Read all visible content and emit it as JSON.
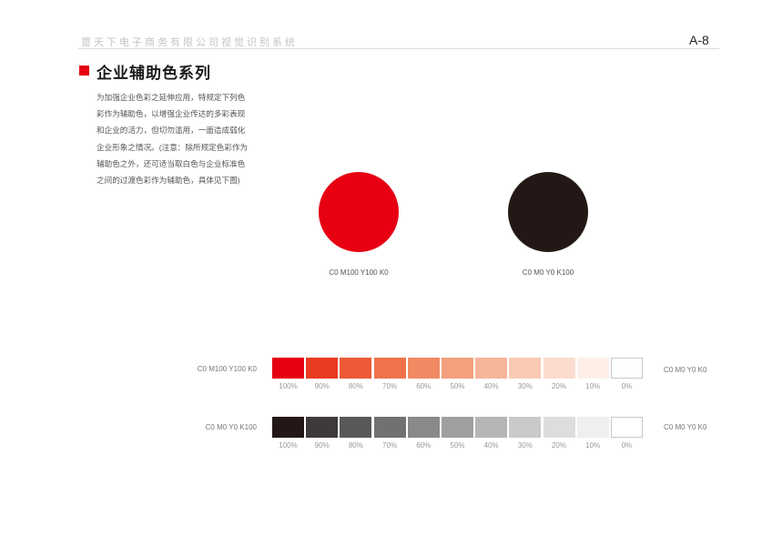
{
  "header": {
    "title": "蔷天下电子商务有限公司视觉识别系统",
    "page_number": "A-8"
  },
  "section": {
    "title": "企业辅助色系列",
    "marker_color": "#e60012",
    "description_lines": [
      "为加强企业色彩之延伸应用，特规定下列色",
      "彩作为辅助色，以增强企业传达的多彩表现",
      "和企业的活力，但切勿滥用，一面造成弱化",
      "企业形象之情况。(注意：除所规定色彩作为",
      "辅助色之外，还可适当取白色与企业标准色",
      "之间的过渡色彩作为辅助色，具体见下图)"
    ]
  },
  "primary_colors": [
    {
      "label": "C0 M100 Y100 K0",
      "hex": "#e60012"
    },
    {
      "label": "C0 M0 Y0 K100",
      "hex": "#231815"
    }
  ],
  "gradients": [
    {
      "start_label": "C0 M100 Y100 K0",
      "end_label": "C0 M0 Y0 K0",
      "swatches": [
        "#e60012",
        "#e93b22",
        "#ec5a36",
        "#ef724a",
        "#f18a62",
        "#f4a17d",
        "#f6b598",
        "#f9c9b4",
        "#fbddcf",
        "#fdefe8",
        "#ffffff"
      ],
      "percents": [
        "100%",
        "90%",
        "80%",
        "70%",
        "60%",
        "50%",
        "40%",
        "30%",
        "20%",
        "10%",
        "0%"
      ]
    },
    {
      "start_label": "C0 M0 Y0 K100",
      "end_label": "C0 M0 Y0 K0",
      "swatches": [
        "#231815",
        "#3e3a39",
        "#595757",
        "#727171",
        "#898989",
        "#9f9fa0",
        "#b5b5b6",
        "#c9caca",
        "#dcdddd",
        "#efefef",
        "#ffffff"
      ],
      "percents": [
        "100%",
        "90%",
        "80%",
        "70%",
        "60%",
        "50%",
        "40%",
        "30%",
        "20%",
        "10%",
        "0%"
      ]
    }
  ]
}
